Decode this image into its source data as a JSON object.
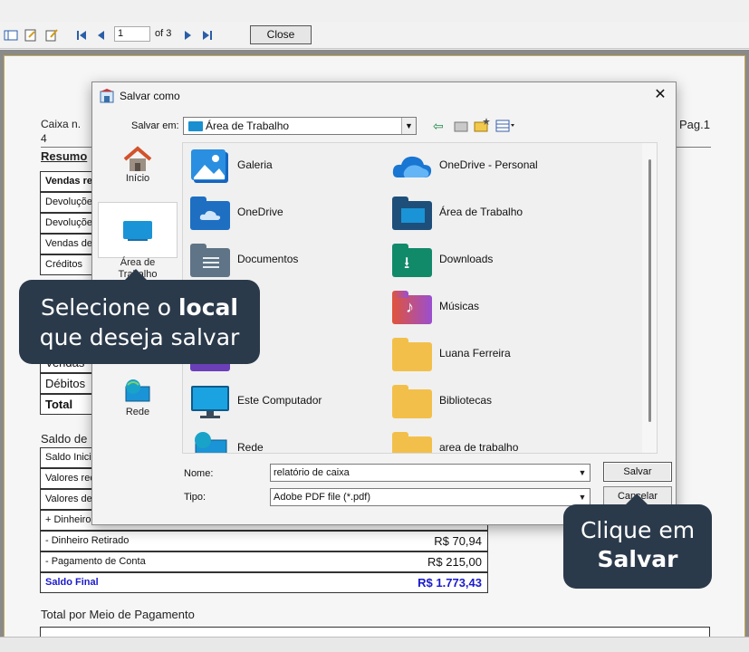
{
  "toolbar": {
    "icons": [
      "page-layout-icon",
      "export-icon",
      "edit-icon",
      "first-page-icon",
      "previous-page-icon",
      "next-page-icon",
      "last-page-icon"
    ],
    "page_value": "1",
    "page_of": "of 3",
    "close_label": "Close"
  },
  "report": {
    "caixa_label": "Caixa n.",
    "caixa_number": "4",
    "resumo_label": "Resumo",
    "page_label": "Pag.1",
    "rows_top": [
      "Vendas re",
      "Devoluções",
      "Devoluções",
      "Vendas de",
      "Créditos ut"
    ],
    "rows_mid": [
      "Vendas",
      "Débitos p",
      "Total rec"
    ],
    "saldo_label": "Saldo de",
    "rows_saldo": [
      {
        "label": "Saldo Inicia",
        "value": ""
      },
      {
        "label": "Valores rec",
        "value": ""
      },
      {
        "label": "Valores de",
        "value": ""
      },
      {
        "label": "+ Dinheiro A",
        "value": ""
      },
      {
        "label": "- Dinheiro Retirado",
        "value": "R$ 70,94"
      },
      {
        "label": "- Pagamento de Conta",
        "value": "R$ 215,00"
      },
      {
        "label": "Saldo Final",
        "value": "R$ 1.773,43"
      }
    ],
    "total_meio_label": "Total por Meio de Pagamento"
  },
  "dialog": {
    "title": "Salvar como",
    "close_glyph": "✕",
    "salvar_em_label": "Salvar em:",
    "location_value": "Área de Trabalho",
    "places": [
      {
        "label": "Início",
        "icon": "home-icon"
      },
      {
        "label": "Área de\nTrabalho",
        "icon": "desktop-icon"
      },
      {
        "label": "Rede",
        "icon": "network-icon"
      }
    ],
    "files": [
      {
        "label": "Galeria",
        "icon": "gallery-icon"
      },
      {
        "label": "OneDrive - Personal",
        "icon": "onedrive-cloud-icon"
      },
      {
        "label": "OneDrive",
        "icon": "onedrive-folder-icon"
      },
      {
        "label": "Área de Trabalho",
        "icon": "desktop-folder-icon"
      },
      {
        "label": "Documentos",
        "icon": "documents-folder-icon"
      },
      {
        "label": "Downloads",
        "icon": "downloads-folder-icon"
      },
      {
        "label": "ens",
        "icon": "images-folder-icon"
      },
      {
        "label": "Músicas",
        "icon": "music-folder-icon"
      },
      {
        "label": "eos",
        "icon": "videos-folder-icon"
      },
      {
        "label": "Luana Ferreira",
        "icon": "user-folder-icon"
      },
      {
        "label": "Este Computador",
        "icon": "computer-icon"
      },
      {
        "label": "Bibliotecas",
        "icon": "libraries-folder-icon"
      },
      {
        "label": "Rede",
        "icon": "network-icon"
      },
      {
        "label": "area de trabalho",
        "icon": "folder-icon"
      }
    ],
    "nome_label": "Nome:",
    "nome_value": "relatório de caixa",
    "tipo_label": "Tipo:",
    "tipo_value": "Adobe PDF file (*.pdf)",
    "salvar_label": "Salvar",
    "cancelar_label": "Cancelar"
  },
  "callouts": {
    "c1_line1_a": "Selecione o ",
    "c1_line1_b": "local",
    "c1_line2": "que deseja salvar",
    "c2_line1": "Clique em",
    "c2_line2": "Salvar"
  },
  "colors": {
    "accent": "#2b3a4b",
    "saldo_final": "#1a1acc"
  }
}
